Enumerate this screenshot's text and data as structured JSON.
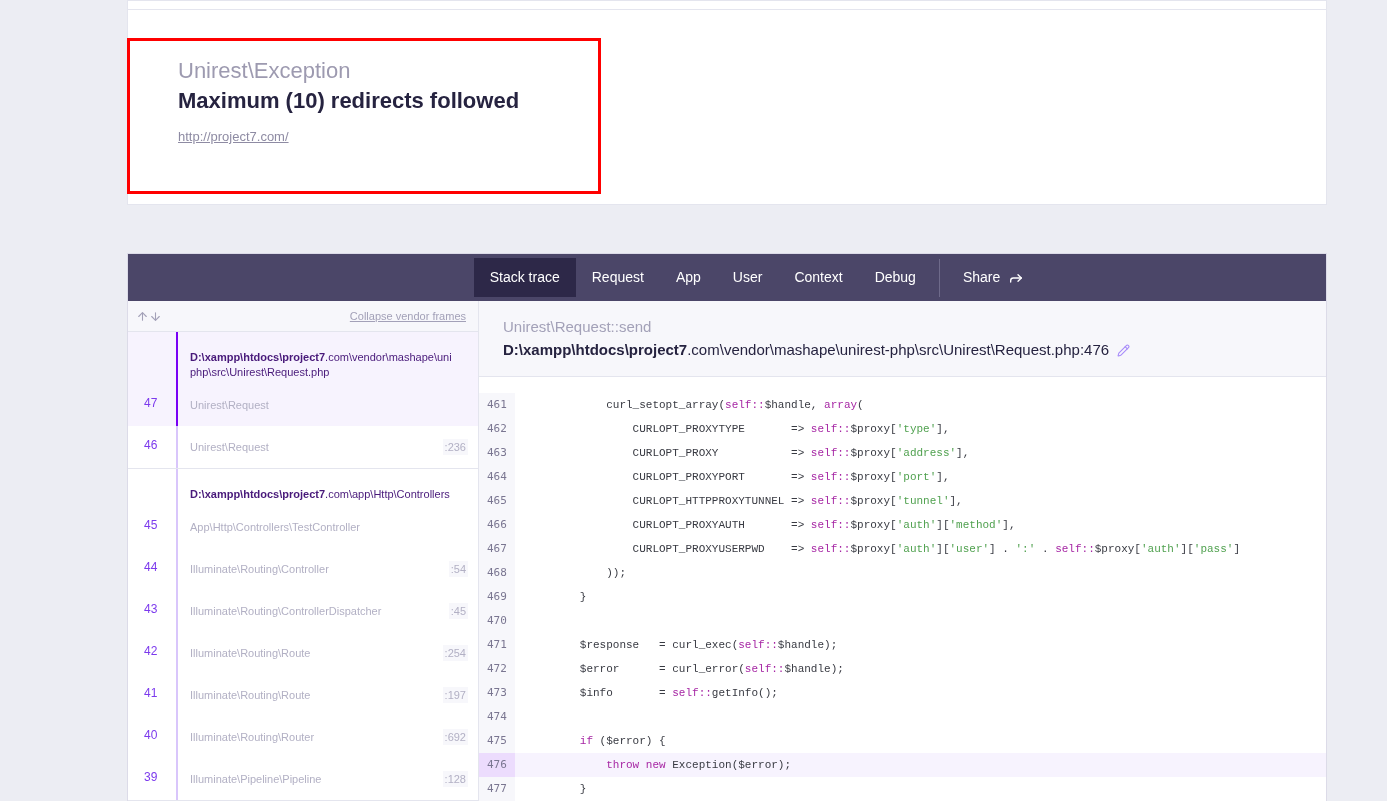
{
  "exception": {
    "class": "Unirest\\Exception",
    "message": "Maximum (10) redirects followed",
    "url": "http://project7.com/"
  },
  "tabs": [
    {
      "label": "Stack trace",
      "selected": true
    },
    {
      "label": "Request",
      "selected": false
    },
    {
      "label": "App",
      "selected": false
    },
    {
      "label": "User",
      "selected": false
    },
    {
      "label": "Context",
      "selected": false
    },
    {
      "label": "Debug",
      "selected": false
    }
  ],
  "share": {
    "label": "Share"
  },
  "frames_panel": {
    "collapse_link": "Collapse vendor frames",
    "groups": [
      {
        "file_lines": [
          "**D:\\xampp\\htdocs\\project7**.com\\vendor\\mashape\\uni",
          "php\\src\\Unirest\\Request.php"
        ],
        "frames": [
          {
            "number": "47",
            "class": "Unirest\\Request",
            "selected": true
          },
          {
            "number": "46",
            "class": "Unirest\\Request",
            "line": ":236",
            "selected": false
          }
        ]
      },
      {
        "file_lines": [
          "**D:\\xampp\\htdocs\\project7**.com\\app\\Http\\Controllers"
        ],
        "frames": [
          {
            "number": "45",
            "class": "App\\Http\\Controllers\\TestController",
            "selected": false
          },
          {
            "number": "44",
            "class": "Illuminate\\Routing\\Controller",
            "line": ":54",
            "selected": false
          },
          {
            "number": "43",
            "class": "Illuminate\\Routing\\ControllerDispatcher",
            "line": ":45",
            "selected": false
          },
          {
            "number": "42",
            "class": "Illuminate\\Routing\\Route",
            "line": ":254",
            "selected": false
          },
          {
            "number": "41",
            "class": "Illuminate\\Routing\\Route",
            "line": ":197",
            "selected": false
          },
          {
            "number": "40",
            "class": "Illuminate\\Routing\\Router",
            "line": ":692",
            "selected": false
          },
          {
            "number": "39",
            "class": "Illuminate\\Pipeline\\Pipeline",
            "line": ":128",
            "selected": false
          }
        ]
      }
    ]
  },
  "code_panel": {
    "method": "Unirest\\Request::send",
    "path": "**D:\\xampp\\htdocs\\project7**.com\\vendor\\mashape\\unirest-php\\src\\Unirest\\Request.php:476",
    "lines": [
      {
        "number": "461",
        "selected": false,
        "tokens": [
          {
            "kind": "plain",
            "text": "            curl_setopt_array("
          },
          {
            "kind": "keyword",
            "text": "self::"
          },
          {
            "kind": "plain",
            "text": "$handle, "
          },
          {
            "kind": "keyword",
            "text": "array"
          },
          {
            "kind": "plain",
            "text": "("
          }
        ]
      },
      {
        "number": "462",
        "selected": false,
        "tokens": [
          {
            "kind": "plain",
            "text": "                CURLOPT_PROXYTYPE       => "
          },
          {
            "kind": "keyword",
            "text": "self::"
          },
          {
            "kind": "plain",
            "text": "$proxy["
          },
          {
            "kind": "string",
            "text": "'type'"
          },
          {
            "kind": "plain",
            "text": "],"
          }
        ]
      },
      {
        "number": "463",
        "selected": false,
        "tokens": [
          {
            "kind": "plain",
            "text": "                CURLOPT_PROXY           => "
          },
          {
            "kind": "keyword",
            "text": "self::"
          },
          {
            "kind": "plain",
            "text": "$proxy["
          },
          {
            "kind": "string",
            "text": "'address'"
          },
          {
            "kind": "plain",
            "text": "],"
          }
        ]
      },
      {
        "number": "464",
        "selected": false,
        "tokens": [
          {
            "kind": "plain",
            "text": "                CURLOPT_PROXYPORT       => "
          },
          {
            "kind": "keyword",
            "text": "self::"
          },
          {
            "kind": "plain",
            "text": "$proxy["
          },
          {
            "kind": "string",
            "text": "'port'"
          },
          {
            "kind": "plain",
            "text": "],"
          }
        ]
      },
      {
        "number": "465",
        "selected": false,
        "tokens": [
          {
            "kind": "plain",
            "text": "                CURLOPT_HTTPPROXYTUNNEL => "
          },
          {
            "kind": "keyword",
            "text": "self::"
          },
          {
            "kind": "plain",
            "text": "$proxy["
          },
          {
            "kind": "string",
            "text": "'tunnel'"
          },
          {
            "kind": "plain",
            "text": "],"
          }
        ]
      },
      {
        "number": "466",
        "selected": false,
        "tokens": [
          {
            "kind": "plain",
            "text": "                CURLOPT_PROXYAUTH       => "
          },
          {
            "kind": "keyword",
            "text": "self::"
          },
          {
            "kind": "plain",
            "text": "$proxy["
          },
          {
            "kind": "string",
            "text": "'auth'"
          },
          {
            "kind": "plain",
            "text": "]["
          },
          {
            "kind": "string",
            "text": "'method'"
          },
          {
            "kind": "plain",
            "text": "],"
          }
        ]
      },
      {
        "number": "467",
        "selected": false,
        "tokens": [
          {
            "kind": "plain",
            "text": "                CURLOPT_PROXYUSERPWD    => "
          },
          {
            "kind": "keyword",
            "text": "self::"
          },
          {
            "kind": "plain",
            "text": "$proxy["
          },
          {
            "kind": "string",
            "text": "'auth'"
          },
          {
            "kind": "plain",
            "text": "]["
          },
          {
            "kind": "string",
            "text": "'user'"
          },
          {
            "kind": "plain",
            "text": "] . "
          },
          {
            "kind": "string",
            "text": "':'"
          },
          {
            "kind": "plain",
            "text": " . "
          },
          {
            "kind": "keyword",
            "text": "self::"
          },
          {
            "kind": "plain",
            "text": "$proxy["
          },
          {
            "kind": "string",
            "text": "'auth'"
          },
          {
            "kind": "plain",
            "text": "]["
          },
          {
            "kind": "string",
            "text": "'pass'"
          },
          {
            "kind": "plain",
            "text": "]"
          }
        ]
      },
      {
        "number": "468",
        "selected": false,
        "tokens": [
          {
            "kind": "plain",
            "text": "            ));"
          }
        ]
      },
      {
        "number": "469",
        "selected": false,
        "tokens": [
          {
            "kind": "plain",
            "text": "        }"
          }
        ]
      },
      {
        "number": "470",
        "selected": false
      },
      {
        "number": "471",
        "selected": false,
        "tokens": [
          {
            "kind": "plain",
            "text": "        $response   = curl_exec("
          },
          {
            "kind": "keyword",
            "text": "self::"
          },
          {
            "kind": "plain",
            "text": "$handle);"
          }
        ]
      },
      {
        "number": "472",
        "selected": false,
        "tokens": [
          {
            "kind": "plain",
            "text": "        $error      = curl_error("
          },
          {
            "kind": "keyword",
            "text": "self::"
          },
          {
            "kind": "plain",
            "text": "$handle);"
          }
        ]
      },
      {
        "number": "473",
        "selected": false,
        "tokens": [
          {
            "kind": "plain",
            "text": "        $info       = "
          },
          {
            "kind": "keyword",
            "text": "self::"
          },
          {
            "kind": "plain",
            "text": "getInfo();"
          }
        ]
      },
      {
        "number": "474",
        "selected": false
      },
      {
        "number": "475",
        "selected": false,
        "tokens": [
          {
            "kind": "keyword",
            "text": "        if"
          },
          {
            "kind": "plain",
            "text": " ($error) {"
          }
        ]
      },
      {
        "number": "476",
        "selected": true,
        "tokens": [
          {
            "kind": "keyword",
            "text": "            throw new"
          },
          {
            "kind": "plain",
            "text": " Exception($error);"
          }
        ]
      },
      {
        "number": "477",
        "selected": false,
        "tokens": [
          {
            "kind": "plain",
            "text": "        }"
          }
        ]
      }
    ]
  }
}
